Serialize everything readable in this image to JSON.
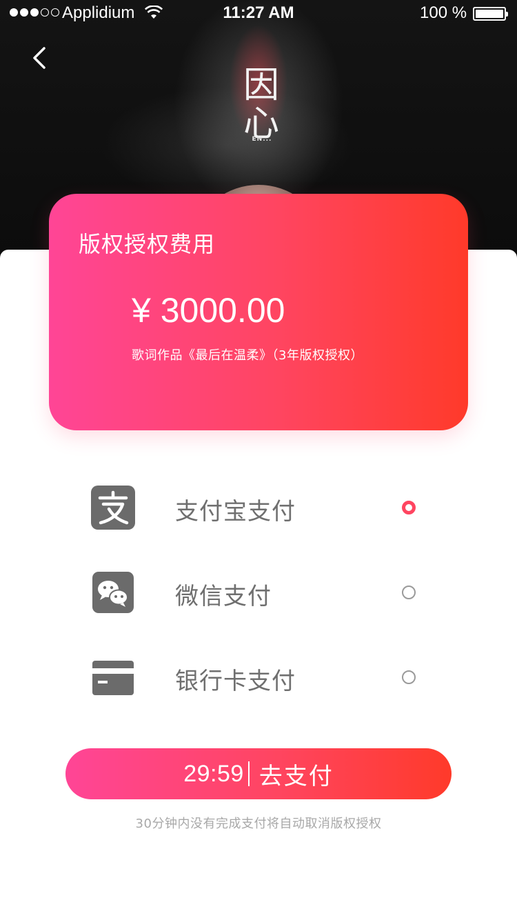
{
  "status_bar": {
    "carrier": "Applidium",
    "time": "11:27 AM",
    "battery": "100 %"
  },
  "hero": {
    "title": "因心",
    "subtitle": "EN..."
  },
  "icons": {
    "back": "chevron-left-icon",
    "alipay": "alipay-icon",
    "wechat": "wechat-icon",
    "bank_card": "credit-card-icon"
  },
  "fee_card": {
    "title": "版权授权费用",
    "amount": "¥ 3000.00",
    "description": "歌词作品《最后在温柔》（3年版权授权）"
  },
  "payment_options": [
    {
      "label": "支付宝支付",
      "selected": true
    },
    {
      "label": "微信支付",
      "selected": false
    },
    {
      "label": "银行卡支付",
      "selected": false
    }
  ],
  "pay_button": {
    "countdown": "29:59",
    "label": "去支付"
  },
  "notice": "30分钟内没有完成支付将自动取消版权授权",
  "colors": {
    "accent_start": "#ff4596",
    "accent_end": "#ff3a2a",
    "icon_gray": "#6b6b6b",
    "label_gray": "#6f6f6f"
  }
}
